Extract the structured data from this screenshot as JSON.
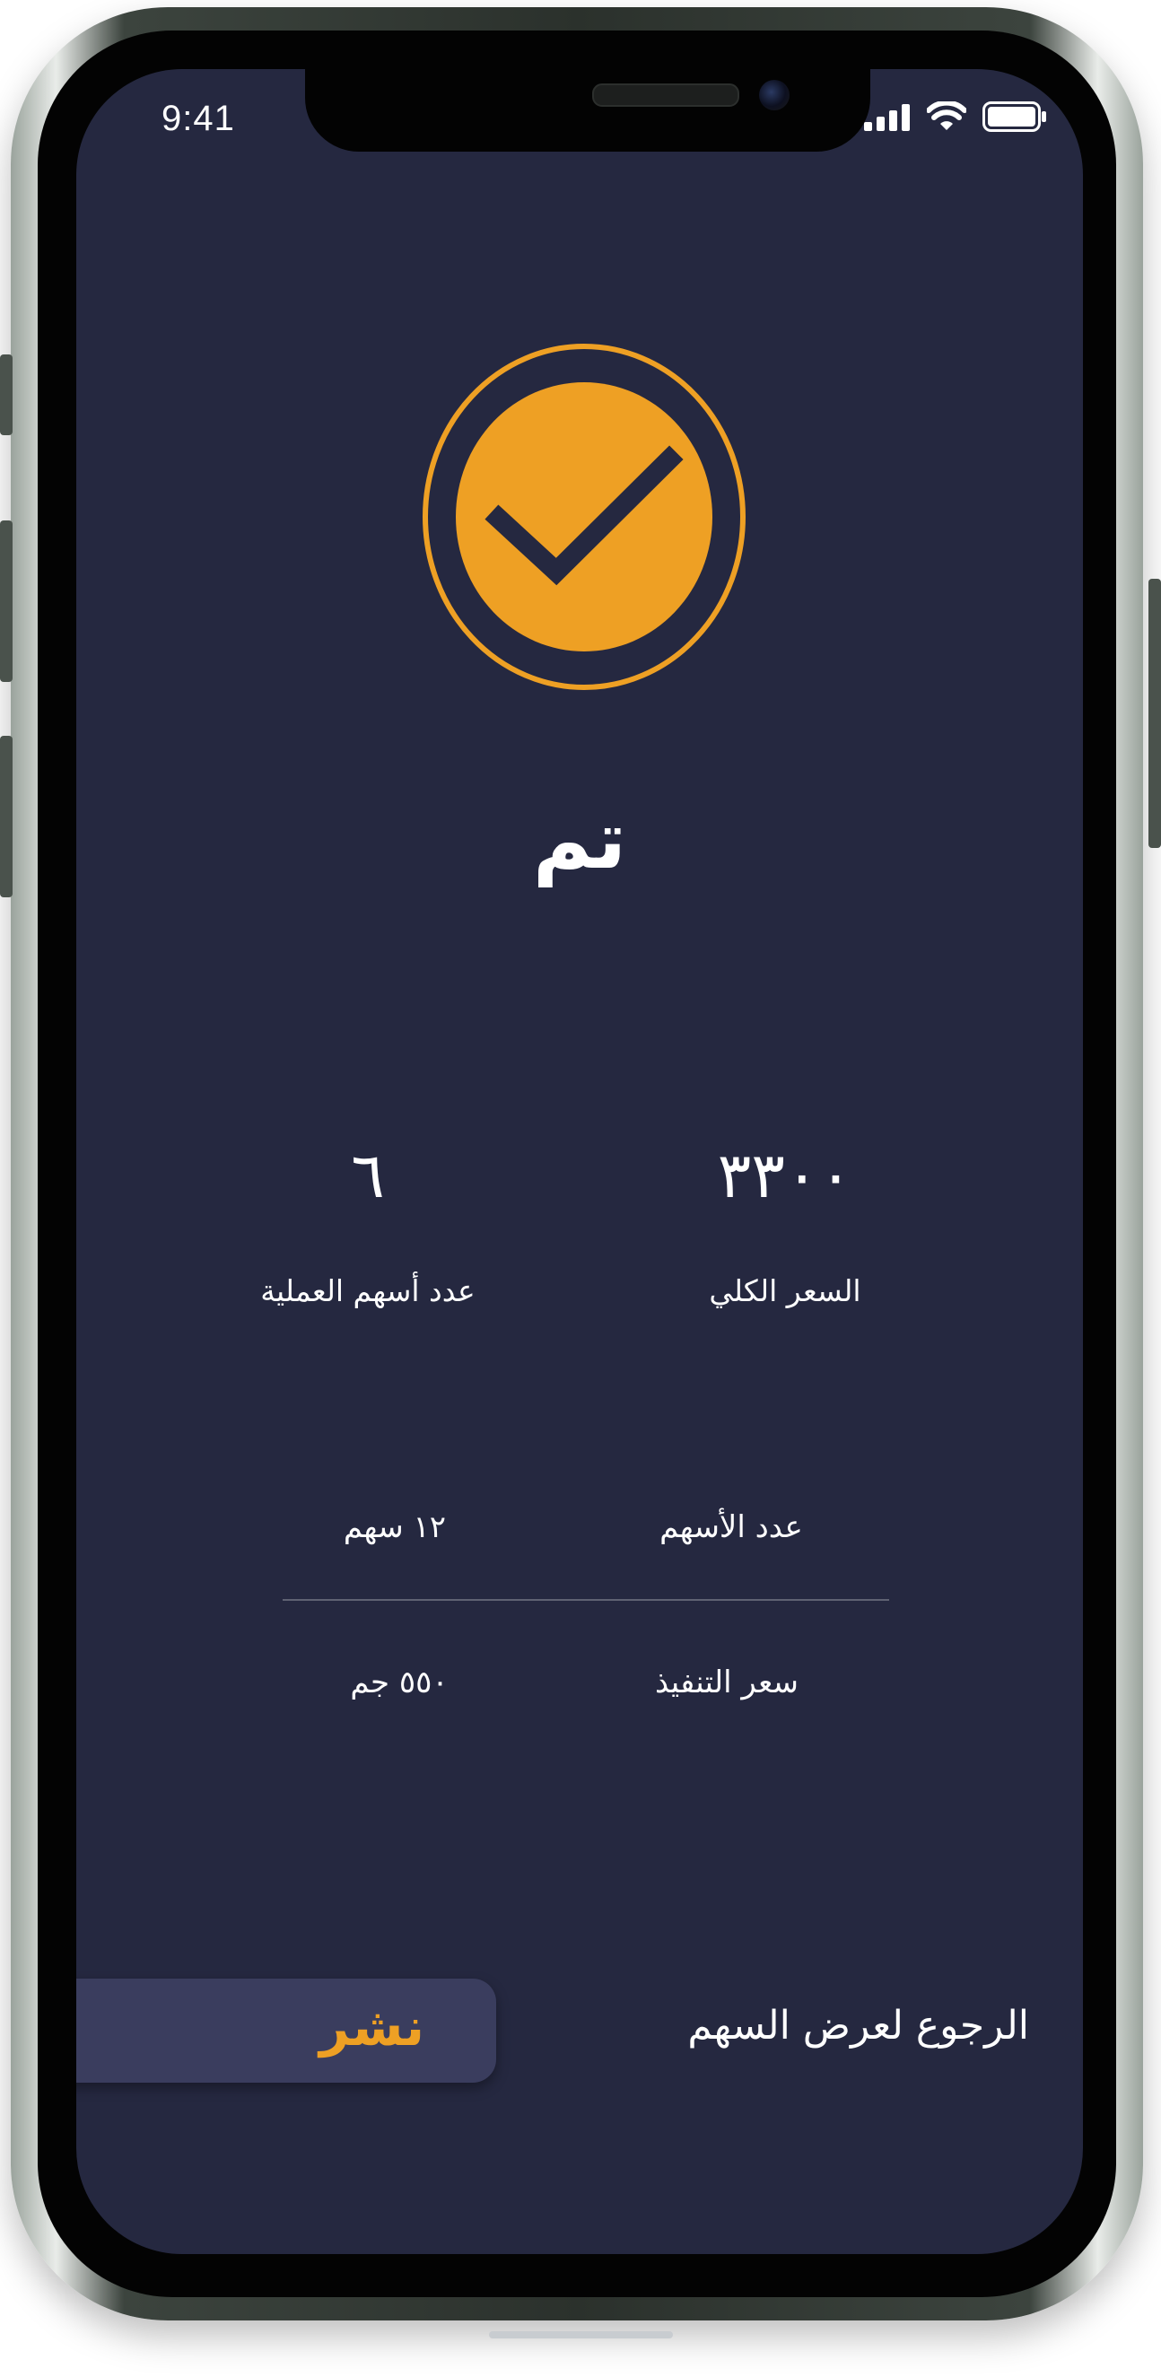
{
  "status_bar": {
    "time": "9:41"
  },
  "success_screen": {
    "title": "تم",
    "stats": [
      {
        "value": "٣٣٠٠",
        "label": "السعر الكلي"
      },
      {
        "value": "٦",
        "label": "عدد أسهم العملية"
      }
    ],
    "details": [
      {
        "label": "عدد الأسهم",
        "value": "١٢ سهم"
      },
      {
        "label": "سعر التنفيذ",
        "value": "٥٥٠ جم"
      }
    ],
    "publish_label": "نشر",
    "back_label": "الرجوع لعرض السهم"
  },
  "colors": {
    "background": "#252840",
    "accent": "#eea024",
    "button": "#3a3d5e",
    "text": "#ffffff"
  },
  "icons": [
    "signal-icon",
    "wifi-icon",
    "battery-icon",
    "checkmark-icon"
  ]
}
